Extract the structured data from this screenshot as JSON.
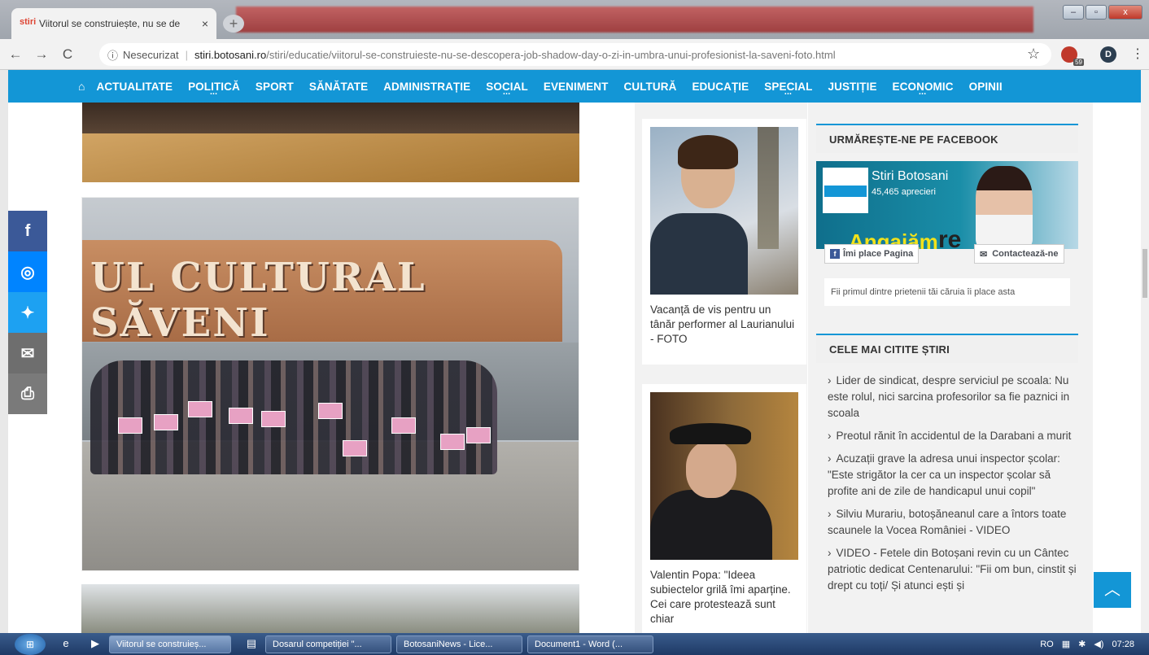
{
  "browser": {
    "tab_title": "Viitorul se construiește, nu se de",
    "tab_close": "×",
    "new_tab": "+",
    "nav_back": "←",
    "nav_forward": "→",
    "reload": "C",
    "security_label": "Nesecurizat",
    "url_domain": "stiri.botosani.ro",
    "url_path": "/stiri/educatie/viitorul-se-construieste-nu-se-descopera-job-shadow-day-o-zi-in-umbra-unui-profesionist-la-saveni-foto.html",
    "ext_badge": "59",
    "profile_letter": "D",
    "window_min": "–",
    "window_max": "▫",
    "window_close": "x"
  },
  "site_nav": {
    "items": [
      {
        "label": "ACTUALITATE"
      },
      {
        "label": "POLITICĂ"
      },
      {
        "label": "SPORT"
      },
      {
        "label": "SĂNĂTATE"
      },
      {
        "label": "ADMINISTRAȚIE"
      },
      {
        "label": "SOCIAL"
      },
      {
        "label": "EVENIMENT"
      },
      {
        "label": "CULTURĂ"
      },
      {
        "label": "EDUCAȚIE"
      },
      {
        "label": "SPECIAL"
      },
      {
        "label": "JUSTIȚIE"
      },
      {
        "label": "ECONOMIC"
      },
      {
        "label": "OPINII"
      }
    ]
  },
  "article": {
    "sign_text": "UL CULTURAL SĂVENI"
  },
  "share_bar": {
    "facebook_color": "#3b5998",
    "messenger_color": "#0084ff",
    "twitter_color": "#1da1f2",
    "email_color": "#6e6e6e",
    "print_color": "#7a7a7a"
  },
  "related": [
    {
      "caption": "Vacanță de vis pentru un tânăr performer al Laurianului - FOTO"
    },
    {
      "caption": "Valentin Popa: \"Ideea subiectelor grilă îmi aparține. Cei care protestează sunt chiar"
    }
  ],
  "facebook_widget": {
    "heading": "URMĂREȘTE-NE PE FACEBOOK",
    "page_name": "Stiri Botosani",
    "likes": "45,465 aprecieri",
    "banner_text_1": "Angajăm",
    "banner_text_2": "re",
    "like_button": "Îmi place Pagina",
    "contact_button": "Contactează-ne",
    "footer": "Fii primul dintre prietenii tăi căruia îi place asta"
  },
  "most_read": {
    "heading": "CELE MAI CITITE ȘTIRI",
    "items": [
      {
        "title": "Lider de sindicat, despre serviciul pe scoala: Nu este rolul, nici sarcina profesorilor sa fie paznici in scoala"
      },
      {
        "title": "Preotul rănit în accidentul de la Darabani a murit"
      },
      {
        "title": "Acuzații grave la adresa unui inspector școlar: \"Este strigător la cer ca un inspector școlar să profite ani de zile de handicapul unui copil\""
      },
      {
        "title": "Silviu Murariu, botoșăneanul care a întors toate scaunele la Vocea României - VIDEO"
      },
      {
        "title": "VIDEO - Fetele din Botoșani revin cu un Cântec patriotic dedicat Centenarului: \"Fii om bun, cinstit și drept cu toți/ Și atunci ești și"
      }
    ]
  },
  "taskbar": {
    "tasks": [
      {
        "label": "Viitorul se construieș..."
      },
      {
        "label": "Dosarul competiției \"..."
      },
      {
        "label": "BotosaniNews - Lice..."
      },
      {
        "label": "Document1 - Word (..."
      }
    ],
    "lang": "RO",
    "clock": "07:28"
  },
  "theme": {
    "accent": "#1396d6"
  }
}
